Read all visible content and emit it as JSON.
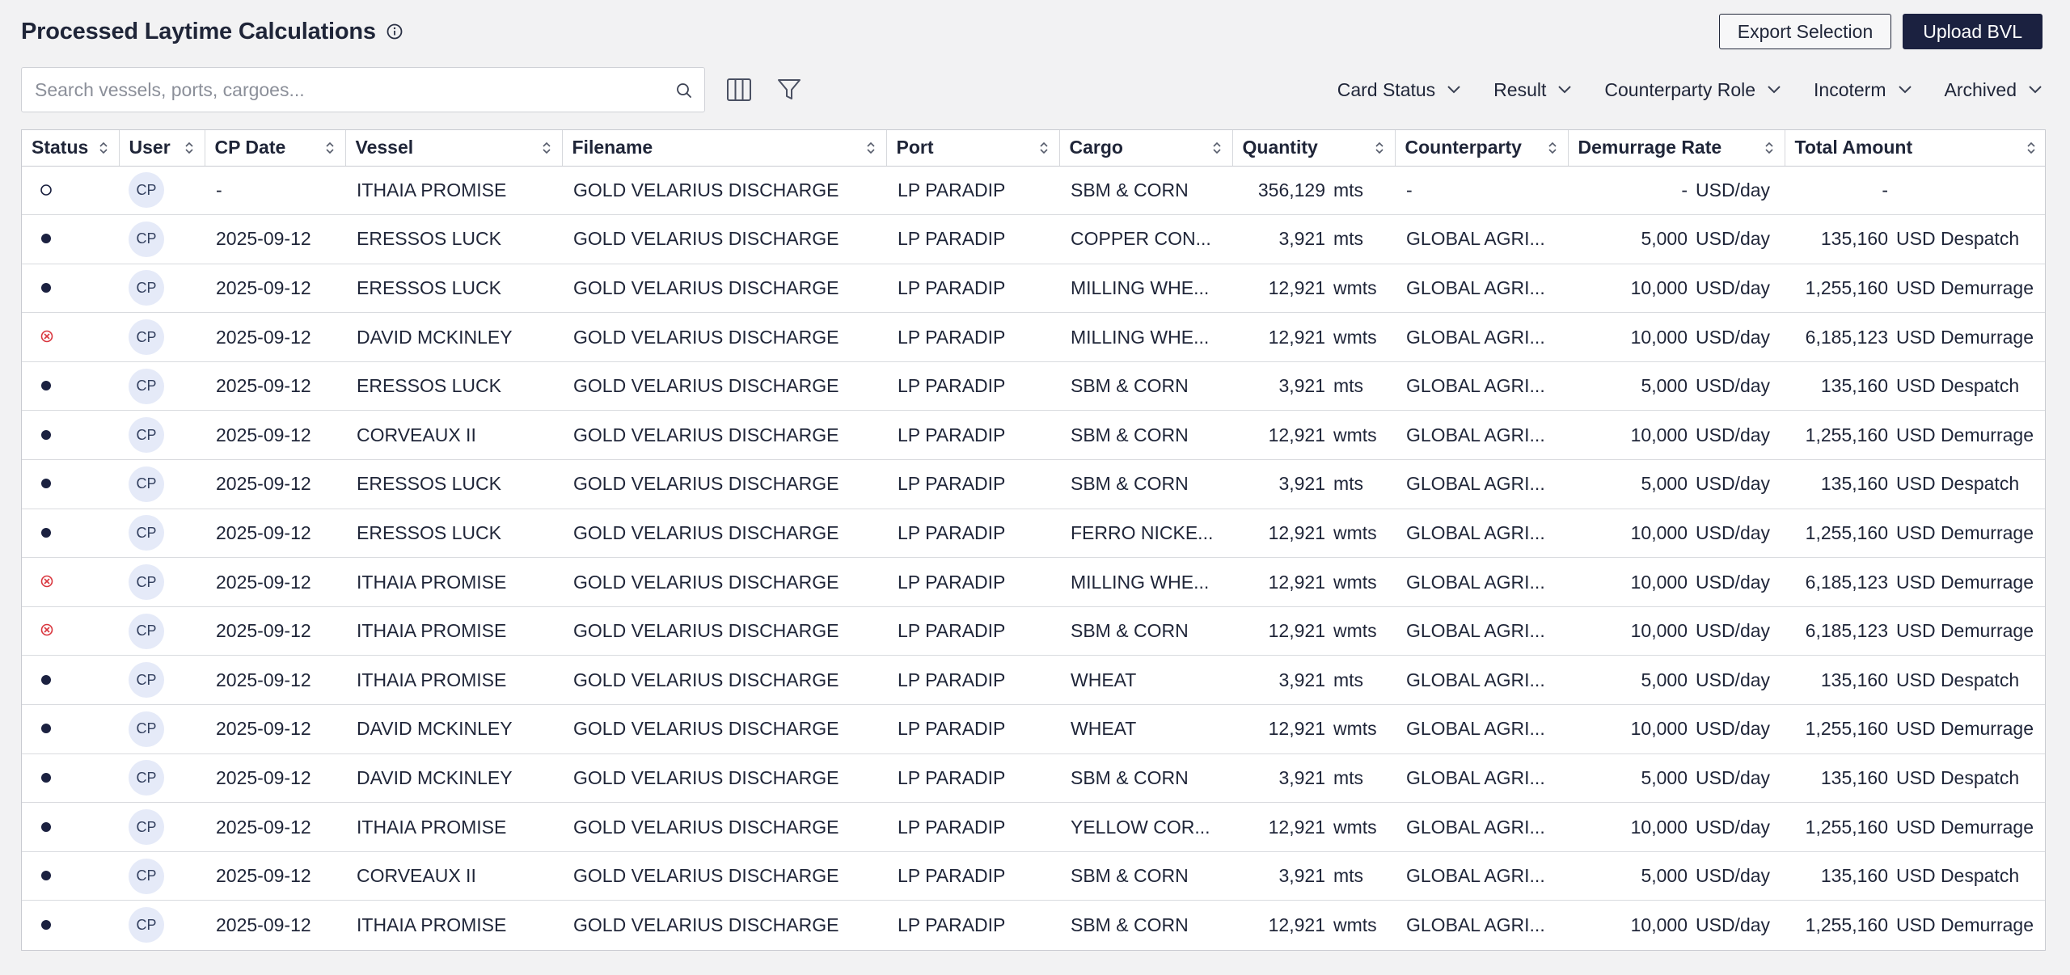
{
  "header": {
    "title": "Processed Laytime Calculations",
    "export_label": "Export Selection",
    "upload_label": "Upload BVL"
  },
  "search": {
    "placeholder": "Search vessels, ports, cargoes..."
  },
  "filters": [
    {
      "label": "Card Status"
    },
    {
      "label": "Result"
    },
    {
      "label": "Counterparty Role"
    },
    {
      "label": "Incoterm"
    },
    {
      "label": "Archived"
    }
  ],
  "columns": [
    {
      "label": "Status"
    },
    {
      "label": "User"
    },
    {
      "label": "CP Date"
    },
    {
      "label": "Vessel"
    },
    {
      "label": "Filename"
    },
    {
      "label": "Port"
    },
    {
      "label": "Cargo"
    },
    {
      "label": "Quantity"
    },
    {
      "label": "Counterparty"
    },
    {
      "label": "Demurrage Rate"
    },
    {
      "label": "Total Amount"
    }
  ],
  "colors": {
    "status_complete": "#1b2140",
    "status_error": "#d9363e",
    "status_pending": "#1b2140",
    "primary": "#1b2140"
  },
  "rows": [
    {
      "status": "pending",
      "user": "CP",
      "cp_date": "-",
      "vessel": "ITHAIA PROMISE",
      "filename": "GOLD VELARIUS DISCHARGE",
      "port": "LP PARADIP",
      "cargo": "SBM & CORN",
      "qty": "356,129",
      "qty_unit": "mts",
      "counterparty": "-",
      "rate": "-",
      "rate_unit": "USD/day",
      "total": "-",
      "total_unit": ""
    },
    {
      "status": "complete",
      "user": "CP",
      "cp_date": "2025-09-12",
      "vessel": "ERESSOS LUCK",
      "filename": "GOLD VELARIUS DISCHARGE",
      "port": "LP PARADIP",
      "cargo": "COPPER CON...",
      "qty": "3,921",
      "qty_unit": "mts",
      "counterparty": "GLOBAL AGRI...",
      "rate": "5,000",
      "rate_unit": "USD/day",
      "total": "135,160",
      "total_unit": "USD Despatch"
    },
    {
      "status": "complete",
      "user": "CP",
      "cp_date": "2025-09-12",
      "vessel": "ERESSOS LUCK",
      "filename": "GOLD VELARIUS DISCHARGE",
      "port": "LP PARADIP",
      "cargo": "MILLING WHE...",
      "qty": "12,921",
      "qty_unit": "wmts",
      "counterparty": "GLOBAL AGRI...",
      "rate": "10,000",
      "rate_unit": "USD/day",
      "total": "1,255,160",
      "total_unit": "USD Demurrage"
    },
    {
      "status": "error",
      "user": "CP",
      "cp_date": "2025-09-12",
      "vessel": "DAVID MCKINLEY",
      "filename": "GOLD VELARIUS DISCHARGE",
      "port": "LP PARADIP",
      "cargo": "MILLING WHE...",
      "qty": "12,921",
      "qty_unit": "wmts",
      "counterparty": "GLOBAL AGRI...",
      "rate": "10,000",
      "rate_unit": "USD/day",
      "total": "6,185,123",
      "total_unit": "USD Demurrage"
    },
    {
      "status": "complete",
      "user": "CP",
      "cp_date": "2025-09-12",
      "vessel": "ERESSOS LUCK",
      "filename": "GOLD VELARIUS DISCHARGE",
      "port": "LP PARADIP",
      "cargo": "SBM & CORN",
      "qty": "3,921",
      "qty_unit": "mts",
      "counterparty": "GLOBAL AGRI...",
      "rate": "5,000",
      "rate_unit": "USD/day",
      "total": "135,160",
      "total_unit": "USD Despatch"
    },
    {
      "status": "complete",
      "user": "CP",
      "cp_date": "2025-09-12",
      "vessel": "CORVEAUX II",
      "filename": "GOLD VELARIUS DISCHARGE",
      "port": "LP PARADIP",
      "cargo": "SBM & CORN",
      "qty": "12,921",
      "qty_unit": "wmts",
      "counterparty": "GLOBAL AGRI...",
      "rate": "10,000",
      "rate_unit": "USD/day",
      "total": "1,255,160",
      "total_unit": "USD Demurrage"
    },
    {
      "status": "complete",
      "user": "CP",
      "cp_date": "2025-09-12",
      "vessel": "ERESSOS LUCK",
      "filename": "GOLD VELARIUS DISCHARGE",
      "port": "LP PARADIP",
      "cargo": "SBM & CORN",
      "qty": "3,921",
      "qty_unit": "mts",
      "counterparty": "GLOBAL AGRI...",
      "rate": "5,000",
      "rate_unit": "USD/day",
      "total": "135,160",
      "total_unit": "USD Despatch"
    },
    {
      "status": "complete",
      "user": "CP",
      "cp_date": "2025-09-12",
      "vessel": "ERESSOS LUCK",
      "filename": "GOLD VELARIUS DISCHARGE",
      "port": "LP PARADIP",
      "cargo": "FERRO NICKE...",
      "qty": "12,921",
      "qty_unit": "wmts",
      "counterparty": "GLOBAL AGRI...",
      "rate": "10,000",
      "rate_unit": "USD/day",
      "total": "1,255,160",
      "total_unit": "USD Demurrage"
    },
    {
      "status": "error",
      "user": "CP",
      "cp_date": "2025-09-12",
      "vessel": "ITHAIA PROMISE",
      "filename": "GOLD VELARIUS DISCHARGE",
      "port": "LP PARADIP",
      "cargo": "MILLING WHE...",
      "qty": "12,921",
      "qty_unit": "wmts",
      "counterparty": "GLOBAL AGRI...",
      "rate": "10,000",
      "rate_unit": "USD/day",
      "total": "6,185,123",
      "total_unit": "USD Demurrage"
    },
    {
      "status": "error",
      "user": "CP",
      "cp_date": "2025-09-12",
      "vessel": "ITHAIA PROMISE",
      "filename": "GOLD VELARIUS DISCHARGE",
      "port": "LP PARADIP",
      "cargo": "SBM & CORN",
      "qty": "12,921",
      "qty_unit": "wmts",
      "counterparty": "GLOBAL AGRI...",
      "rate": "10,000",
      "rate_unit": "USD/day",
      "total": "6,185,123",
      "total_unit": "USD Demurrage"
    },
    {
      "status": "complete",
      "user": "CP",
      "cp_date": "2025-09-12",
      "vessel": "ITHAIA PROMISE",
      "filename": "GOLD VELARIUS DISCHARGE",
      "port": "LP PARADIP",
      "cargo": "WHEAT",
      "qty": "3,921",
      "qty_unit": "mts",
      "counterparty": "GLOBAL AGRI...",
      "rate": "5,000",
      "rate_unit": "USD/day",
      "total": "135,160",
      "total_unit": "USD Despatch"
    },
    {
      "status": "complete",
      "user": "CP",
      "cp_date": "2025-09-12",
      "vessel": "DAVID MCKINLEY",
      "filename": "GOLD VELARIUS DISCHARGE",
      "port": "LP PARADIP",
      "cargo": "WHEAT",
      "qty": "12,921",
      "qty_unit": "wmts",
      "counterparty": "GLOBAL AGRI...",
      "rate": "10,000",
      "rate_unit": "USD/day",
      "total": "1,255,160",
      "total_unit": "USD Demurrage"
    },
    {
      "status": "complete",
      "user": "CP",
      "cp_date": "2025-09-12",
      "vessel": "DAVID MCKINLEY",
      "filename": "GOLD VELARIUS DISCHARGE",
      "port": "LP PARADIP",
      "cargo": "SBM & CORN",
      "qty": "3,921",
      "qty_unit": "mts",
      "counterparty": "GLOBAL AGRI...",
      "rate": "5,000",
      "rate_unit": "USD/day",
      "total": "135,160",
      "total_unit": "USD Despatch"
    },
    {
      "status": "complete",
      "user": "CP",
      "cp_date": "2025-09-12",
      "vessel": "ITHAIA PROMISE",
      "filename": "GOLD VELARIUS DISCHARGE",
      "port": "LP PARADIP",
      "cargo": "YELLOW COR...",
      "qty": "12,921",
      "qty_unit": "wmts",
      "counterparty": "GLOBAL AGRI...",
      "rate": "10,000",
      "rate_unit": "USD/day",
      "total": "1,255,160",
      "total_unit": "USD Demurrage"
    },
    {
      "status": "complete",
      "user": "CP",
      "cp_date": "2025-09-12",
      "vessel": "CORVEAUX II",
      "filename": "GOLD VELARIUS DISCHARGE",
      "port": "LP PARADIP",
      "cargo": "SBM & CORN",
      "qty": "3,921",
      "qty_unit": "mts",
      "counterparty": "GLOBAL AGRI...",
      "rate": "5,000",
      "rate_unit": "USD/day",
      "total": "135,160",
      "total_unit": "USD Despatch"
    },
    {
      "status": "complete",
      "user": "CP",
      "cp_date": "2025-09-12",
      "vessel": "ITHAIA PROMISE",
      "filename": "GOLD VELARIUS DISCHARGE",
      "port": "LP PARADIP",
      "cargo": "SBM & CORN",
      "qty": "12,921",
      "qty_unit": "wmts",
      "counterparty": "GLOBAL AGRI...",
      "rate": "10,000",
      "rate_unit": "USD/day",
      "total": "1,255,160",
      "total_unit": "USD Demurrage"
    }
  ]
}
